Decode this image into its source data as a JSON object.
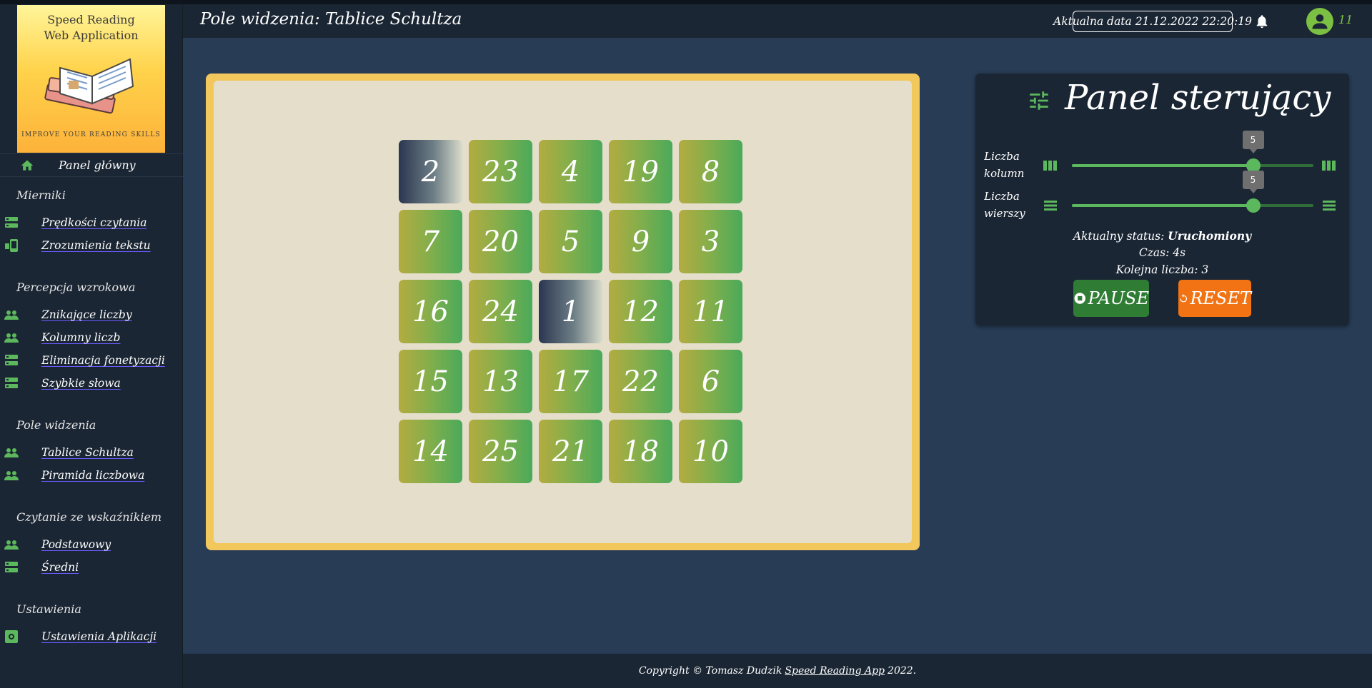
{
  "app": {
    "logo_line1": "Speed Reading",
    "logo_line2": "Web Application",
    "logo_tagline": "IMPROVE YOUR READING SKILLS"
  },
  "header": {
    "title": "Pole widzenia: Tablice Schultza",
    "date_label": "Aktualna data 21.12.2022 22:20:19",
    "user_number": "11"
  },
  "sidebar": {
    "home": {
      "label": "Panel główny",
      "icon": "home-icon"
    },
    "sections": [
      {
        "title": "Mierniki",
        "items": [
          {
            "label": "Prędkości czytania",
            "icon": "storage-icon"
          },
          {
            "label": "Zrozumienia tekstu",
            "icon": "phonelink-icon"
          }
        ]
      },
      {
        "title": "Percepcja wzrokowa",
        "items": [
          {
            "label": "Znikające liczby",
            "icon": "people-icon"
          },
          {
            "label": "Kolumny liczb",
            "icon": "people-icon"
          },
          {
            "label": "Eliminacja fonetyzacji",
            "icon": "storage-icon"
          },
          {
            "label": "Szybkie słowa",
            "icon": "storage-icon"
          }
        ]
      },
      {
        "title": "Pole widzenia",
        "items": [
          {
            "label": "Tablice Schultza",
            "icon": "people-icon"
          },
          {
            "label": "Piramida liczbowa",
            "icon": "people-icon"
          }
        ]
      },
      {
        "title": "Czytanie ze wskaźnikiem",
        "items": [
          {
            "label": "Podstawowy",
            "icon": "people-icon"
          },
          {
            "label": "Średni",
            "icon": "storage-icon"
          }
        ]
      },
      {
        "title": "Ustawienia",
        "items": [
          {
            "label": "Ustawienia Aplikacji",
            "icon": "settings-app-icon"
          }
        ]
      }
    ]
  },
  "board": {
    "columns": 5,
    "rows": 5,
    "cells": [
      {
        "n": "2",
        "found": true
      },
      {
        "n": "23",
        "found": false
      },
      {
        "n": "4",
        "found": false
      },
      {
        "n": "19",
        "found": false
      },
      {
        "n": "8",
        "found": false
      },
      {
        "n": "7",
        "found": false
      },
      {
        "n": "20",
        "found": false
      },
      {
        "n": "5",
        "found": false
      },
      {
        "n": "9",
        "found": false
      },
      {
        "n": "3",
        "found": false
      },
      {
        "n": "16",
        "found": false
      },
      {
        "n": "24",
        "found": false
      },
      {
        "n": "1",
        "found": true
      },
      {
        "n": "12",
        "found": false
      },
      {
        "n": "11",
        "found": false
      },
      {
        "n": "15",
        "found": false
      },
      {
        "n": "13",
        "found": false
      },
      {
        "n": "17",
        "found": false
      },
      {
        "n": "22",
        "found": false
      },
      {
        "n": "6",
        "found": false
      },
      {
        "n": "14",
        "found": false
      },
      {
        "n": "25",
        "found": false
      },
      {
        "n": "21",
        "found": false
      },
      {
        "n": "18",
        "found": false
      },
      {
        "n": "10",
        "found": false
      }
    ]
  },
  "panel": {
    "title": "Panel sterujący",
    "columns_label_1": "Liczba",
    "columns_label_2": "kolumn",
    "columns_value": "5",
    "columns_fraction": 0.75,
    "rows_label_1": "Liczba",
    "rows_label_2": "wierszy",
    "rows_value": "5",
    "rows_fraction": 0.75,
    "status_label": "Aktualny status:",
    "status_value": "Uruchomiony",
    "time_label": "Czas: 4s",
    "next_label": "Kolejna liczba: 3",
    "pause_label": "PAUSE",
    "reset_label": "RESET"
  },
  "footer": {
    "text_before": "Copyright © Tomasz Dudzik",
    "link": "Speed Reading App",
    "text_after": "2022."
  },
  "colors": {
    "accent_green": "#5cb85c",
    "pause_green": "#2f7d35",
    "reset_orange": "#f27313",
    "board_frame": "#f2c75c"
  }
}
